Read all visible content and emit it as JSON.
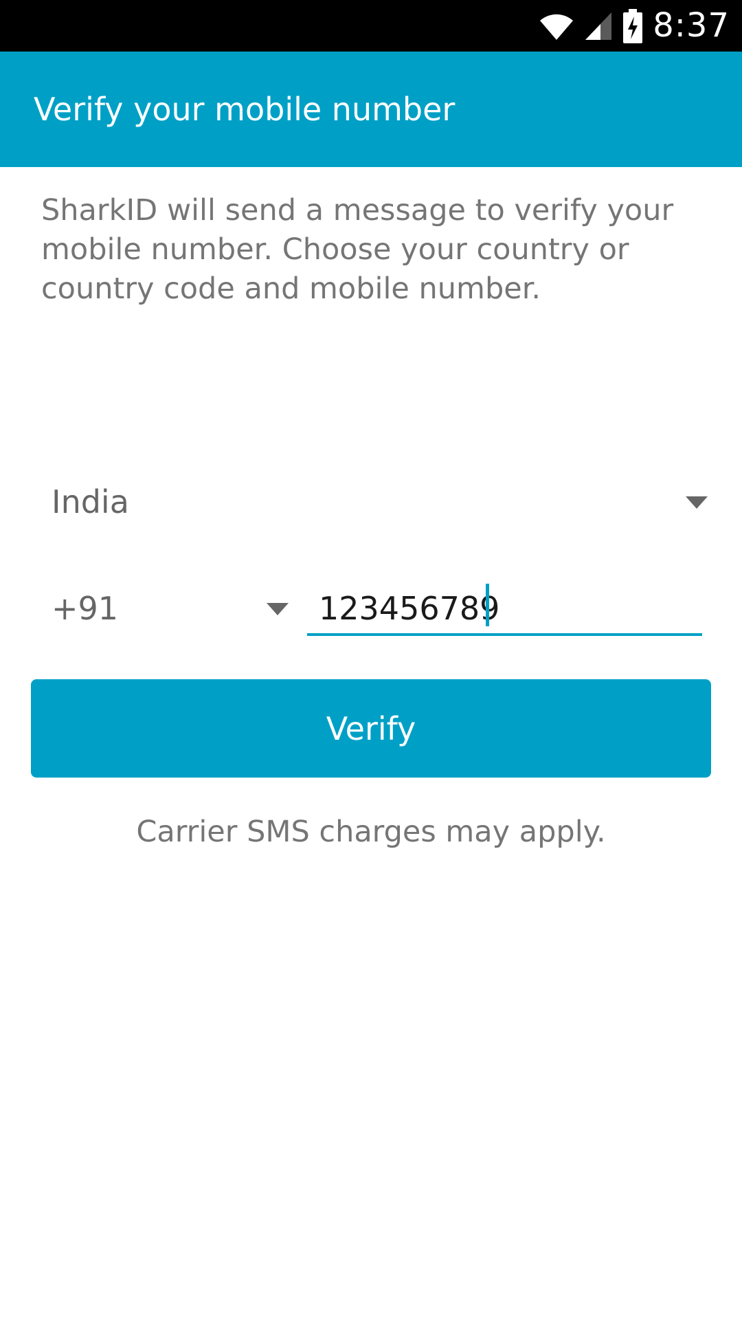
{
  "status_bar": {
    "time": "8:37",
    "icons": [
      "wifi-icon",
      "signal-icon",
      "battery-charging-icon"
    ]
  },
  "app_bar": {
    "title": "Verify your mobile number"
  },
  "description": "SharkID will send a message to verify your mobile number. Choose your country or country code and mobile number.",
  "form": {
    "country": "India",
    "country_code": "+91",
    "phone_number": "123456789"
  },
  "verify_button": {
    "label": "Verify"
  },
  "note": "Carrier SMS charges may apply.",
  "colors": {
    "accent": "#00a0c6",
    "status_bar": "#000000",
    "secondary_text": "#757575"
  }
}
